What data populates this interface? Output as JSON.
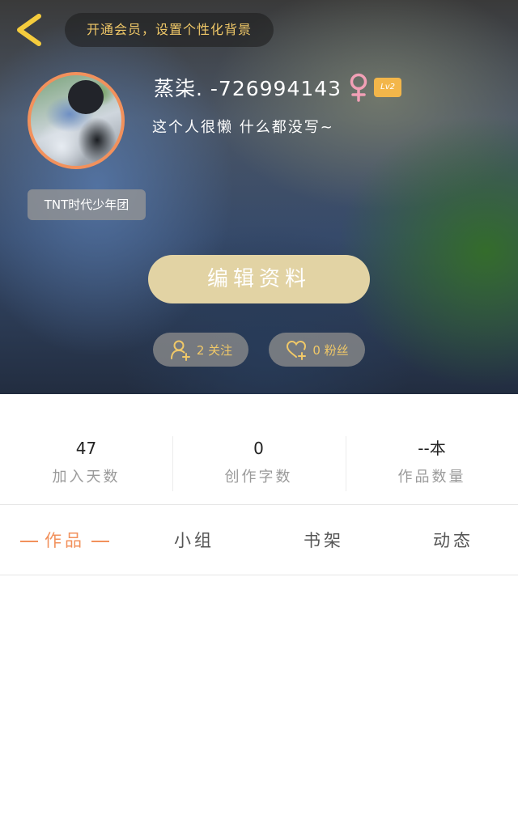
{
  "header": {
    "vip_promo": "开通会员，设置个性化背景",
    "back_icon": "chevron-left-icon"
  },
  "profile": {
    "username": "蒸柒. -726994143",
    "gender_icon": "female-icon",
    "level_badge": "Lv2",
    "bio": "这个人很懒 什么都没写~",
    "group_tag": "TNT时代少年团",
    "edit_button": "编辑资料",
    "follow_label": "2 关注",
    "fans_label": "0 粉丝"
  },
  "stats": [
    {
      "value": "47",
      "label": "加入天数"
    },
    {
      "value": "0",
      "label": "创作字数"
    },
    {
      "value": "--本",
      "label": "作品数量"
    }
  ],
  "tabs": [
    {
      "label": "作品",
      "active": true
    },
    {
      "label": "小组",
      "active": false
    },
    {
      "label": "书架",
      "active": false
    },
    {
      "label": "动态",
      "active": false
    }
  ],
  "colors": {
    "accent": "#f2915c",
    "gold_text": "#f0c868",
    "edit_button_bg": "#e2d3a4",
    "female_icon": "#f2a0b6",
    "level_badge_bg": "#f3b64a"
  }
}
